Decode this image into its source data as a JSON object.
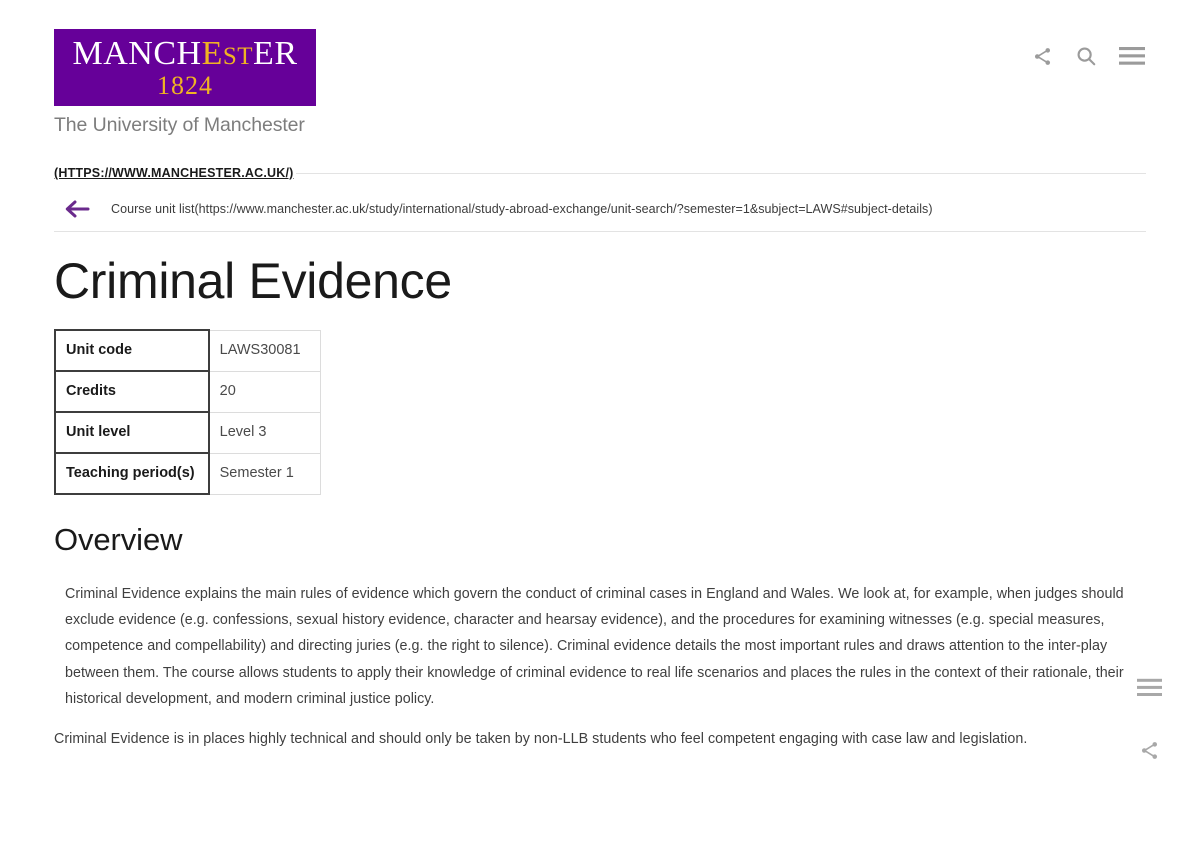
{
  "header": {
    "logo": {
      "word_part1": "MANCH",
      "word_part2": "E",
      "word_part3": "ST",
      "word_part4": "ER",
      "year": "1824",
      "strapline": "The University of Manchester",
      "background_color": "#660099",
      "accent_color": "#f0b323"
    },
    "icons": [
      {
        "name": "share-icon",
        "label": "Share"
      },
      {
        "name": "search-icon",
        "label": "Search"
      },
      {
        "name": "menu-icon",
        "label": "Menu"
      }
    ]
  },
  "breadcrumb": {
    "home_link": "(HTTPS://WWW.MANCHESTER.AC.UK/)",
    "back_arrow": "←",
    "back_link": "Course unit list(https://www.manchester.ac.uk/study/international/study-abroad-exchange/unit-search/?semester=1&subject=LAWS#subject-details)",
    "accent_color": "#6a2a8c"
  },
  "main": {
    "title": "Criminal Evidence",
    "info_table": {
      "rows": [
        {
          "label": "Unit code",
          "value": "LAWS30081"
        },
        {
          "label": "Credits",
          "value": "20"
        },
        {
          "label": "Unit level",
          "value": "Level 3"
        },
        {
          "label": "Teaching period(s)",
          "value": "Semester 1"
        }
      ]
    },
    "overview": {
      "heading": "Overview",
      "paragraph_1": "Criminal Evidence explains the main rules of evidence which govern the conduct of criminal cases in England and Wales. We look at, for example, when judges should exclude evidence (e.g. confessions, sexual history evidence, character and hearsay evidence), and the procedures for examining witnesses (e.g. special measures, competence and compellability) and directing juries (e.g. the right to silence). Criminal evidence details the most important rules and draws attention to the inter-play between them. The course allows students to apply their knowledge of criminal evidence to real life scenarios and places the rules in the context of their rationale, their historical development, and modern criminal justice policy.",
      "paragraph_2": "Criminal Evidence is in places highly technical and should only be taken by non-LLB students who feel competent engaging with case law and legislation."
    }
  },
  "side_icons": [
    {
      "name": "menu-icon",
      "label": "Menu"
    },
    {
      "name": "share-icon",
      "label": "Share"
    }
  ]
}
